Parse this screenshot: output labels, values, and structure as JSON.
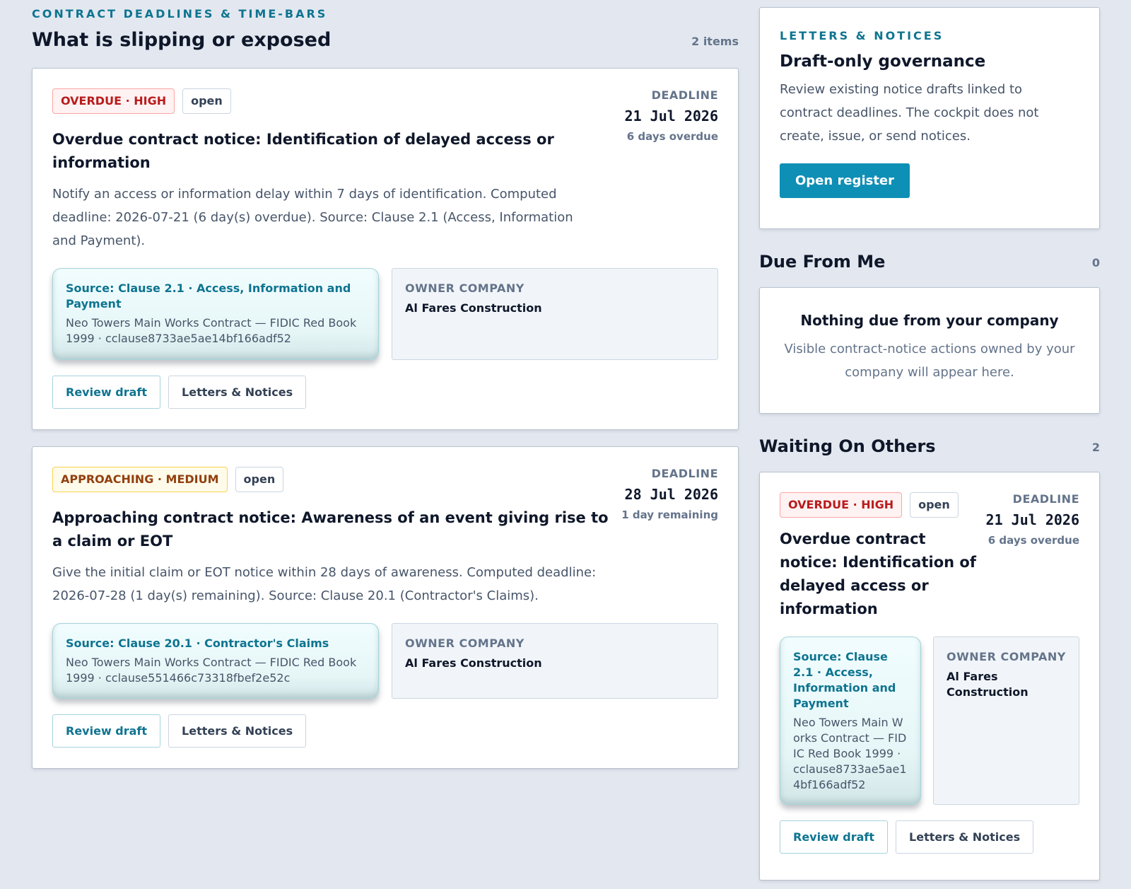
{
  "main": {
    "eyebrow": "CONTRACT DEADLINES & TIME-BARS",
    "title": "What is slipping or exposed",
    "count": "2 items",
    "items": [
      {
        "severity": "OVERDUE · HIGH",
        "status": "open",
        "deadline_label": "DEADLINE",
        "deadline_date": "21 Jul 2026",
        "deadline_relative": "6 days overdue",
        "title": "Overdue contract notice: Identification of delayed access or information",
        "description": "Notify an access or information delay within 7 days of identification. Computed deadline: 2026-07-21 (6 day(s) overdue). Source: Clause 2.1 (Access, Information and Payment).",
        "source_title": "Source: Clause 2.1 · Access, Information and Payment",
        "source_sub": "Neo Towers Main Works Contract — FIDIC Red Book 1999 · cclause8733ae5ae14bf166adf52",
        "owner_label": "OWNER COMPANY",
        "owner_name": "Al Fares Construction",
        "review_label": "Review draft",
        "letters_label": "Letters & Notices"
      },
      {
        "severity": "APPROACHING · MEDIUM",
        "status": "open",
        "deadline_label": "DEADLINE",
        "deadline_date": "28 Jul 2026",
        "deadline_relative": "1 day remaining",
        "title": "Approaching contract notice: Awareness of an event giving rise to a claim or EOT",
        "description": "Give the initial claim or EOT notice within 28 days of awareness. Computed deadline: 2026-07-28 (1 day(s) remaining). Source: Clause 20.1 (Contractor's Claims).",
        "source_title": "Source: Clause 20.1 · Contractor's Claims",
        "source_sub": "Neo Towers Main Works Contract — FIDIC Red Book 1999 · cclause551466c73318fbef2e52c",
        "owner_label": "OWNER COMPANY",
        "owner_name": "Al Fares Construction",
        "review_label": "Review draft",
        "letters_label": "Letters & Notices"
      }
    ]
  },
  "letters": {
    "eyebrow": "LETTERS & NOTICES",
    "title": "Draft-only governance",
    "description": "Review existing notice drafts linked to contract deadlines. The cockpit does not create, issue, or send notices.",
    "button": "Open register"
  },
  "due_from_me": {
    "title": "Due From Me",
    "count": "0",
    "empty_title": "Nothing due from your company",
    "empty_desc": "Visible contract-notice actions owned by your company will appear here."
  },
  "waiting": {
    "title": "Waiting On Others",
    "count": "2",
    "item": {
      "severity": "OVERDUE · HIGH",
      "status": "open",
      "deadline_label": "DEADLINE",
      "deadline_date": "21 Jul 2026",
      "deadline_relative": "6 days overdue",
      "title": "Overdue contract notice: Identification of delayed access or information",
      "source_title": "Source: Clause 2.1 · Access, Information and Payment",
      "source_sub": "Neo Towers Main Works Contract — FIDIC Red Book 1999 · cclause8733ae5ae14bf166adf52",
      "owner_label": "OWNER COMPANY",
      "owner_name": "Al Fares Construction",
      "review_label": "Review draft",
      "letters_label": "Letters & Notices"
    }
  }
}
